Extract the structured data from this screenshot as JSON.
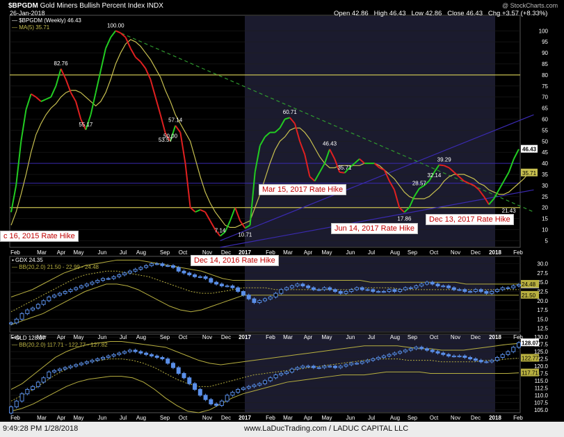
{
  "header": {
    "symbol": "$BPGDM",
    "title": "Gold Miners Bullish Percent Index",
    "exchange": "INDX",
    "date": "26-Jan-2018",
    "watermark": "@ StockCharts.com",
    "open_label": "Open",
    "open": "42.86",
    "high_label": "High",
    "high": "46.43",
    "low_label": "Low",
    "low": "42.86",
    "close_label": "Close",
    "close": "46.43",
    "chg_label": "Chg",
    "chg": "+3.57 (+8.33%)"
  },
  "colors": {
    "up": "#22cc22",
    "down": "#e02020",
    "ma": "#c8c050",
    "trend": "#3a2ab0",
    "dashed": "#2f9a2f",
    "hline": "#c8c050",
    "shade": "#1b1b2e",
    "bar": "#5a8fe8",
    "bb": "#b8b040"
  },
  "footer": {
    "timestamp": "9:49:28 PM 1/28/2018",
    "credit": "www.LaDucTrading.com / LADUC CAPITAL LLC"
  },
  "callouts": [
    "c 16, 2015 Rate Hike",
    "Dec 14, 2016 Rate Hike",
    "Mar 15, 2017 Rate Hike",
    "Jun 14, 2017 Rate Hike",
    "Dec 13, 2017 Rate Hike"
  ],
  "chart_data": [
    {
      "type": "line",
      "legend": [
        "$BPGDM (Weekly) 46.43",
        "MA(5) 35.71"
      ],
      "x_labels": [
        "Feb",
        "Mar",
        "Apr",
        "May",
        "Jun",
        "Jul",
        "Aug",
        "Sep",
        "Oct",
        "Nov",
        "Dec",
        "2017",
        "Feb",
        "Mar",
        "Apr",
        "May",
        "Jun",
        "Jul",
        "Aug",
        "Sep",
        "Oct",
        "Nov",
        "Dec",
        "2018",
        "Feb"
      ],
      "ylim": [
        2,
        107
      ],
      "y_ticks": [
        5,
        10,
        15,
        20,
        25,
        30,
        35,
        40,
        45,
        50,
        55,
        60,
        65,
        70,
        75,
        80,
        85,
        90,
        95,
        100
      ],
      "hlines": [
        80,
        20
      ],
      "hline_blue": [
        31,
        40
      ],
      "last_value_labels": [
        "46.43",
        "35.71"
      ],
      "series": [
        {
          "name": "$BPGDM (Weekly)",
          "values": [
            17.9,
            30,
            50,
            64.3,
            71.4,
            70,
            68,
            69,
            70,
            75,
            82.8,
            78,
            72,
            68,
            60,
            55.2,
            62,
            72,
            82,
            92,
            97,
            100,
            99,
            97,
            92,
            88,
            86,
            83,
            78,
            70,
            62,
            53.6,
            50,
            57.1,
            54,
            40,
            20,
            18,
            19,
            18,
            14,
            10,
            7.1,
            9,
            14,
            20,
            14,
            10.7,
            12,
            36,
            48,
            52,
            54,
            54,
            56,
            60,
            60.7,
            58,
            50,
            44,
            34,
            32,
            36,
            40,
            46.4,
            42,
            36,
            35.7,
            38,
            40,
            42,
            40,
            40,
            40,
            38,
            37,
            32,
            28,
            20,
            17.9,
            20,
            25,
            28.6,
            30,
            32.1,
            36,
            39.3,
            39,
            38,
            36,
            34,
            32,
            31,
            30,
            28,
            25,
            21.4,
            24,
            28,
            32,
            36,
            42,
            46.4
          ]
        },
        {
          "name": "MA(5)",
          "values": [
            12,
            18,
            26,
            35,
            45,
            53,
            58,
            62,
            65,
            67,
            70,
            72,
            73,
            73,
            72,
            70,
            68,
            66,
            68,
            72,
            78,
            85,
            90,
            94,
            96,
            95,
            93,
            90,
            87,
            83,
            79,
            73,
            68,
            62,
            58,
            54,
            50,
            42,
            34,
            27,
            22,
            18,
            15,
            12,
            11,
            11,
            12,
            13,
            14,
            20,
            26,
            33,
            40,
            46,
            50,
            52,
            55,
            56,
            56,
            54,
            51,
            47,
            43,
            40,
            38,
            38,
            39,
            39,
            39,
            39,
            39,
            40,
            40,
            40,
            39,
            37,
            35,
            33,
            30,
            27,
            25,
            24,
            24,
            24,
            25,
            27,
            29,
            32,
            34,
            35,
            35,
            35,
            34,
            33,
            31,
            30,
            28,
            27,
            26,
            26,
            27,
            29,
            31,
            33,
            35.7
          ]
        }
      ],
      "annotations": [
        "100.00",
        "82.76",
        "55.17",
        "53.57",
        "50.00",
        "57.14",
        "7.14",
        "10.71",
        "60.71",
        "46.43",
        "35.71",
        "17.86",
        "28.57",
        "32.14",
        "39.29",
        "21.43"
      ]
    },
    {
      "type": "candlestick",
      "legend": [
        "GDX 24.35",
        "BB(20,2.0) 21.50 - 22.99 - 24.48"
      ],
      "ylim": [
        11.5,
        32
      ],
      "y_ticks": [
        12.5,
        15.0,
        17.5,
        20.0,
        22.5,
        25.0,
        27.5,
        30.0
      ],
      "last_value_labels": [
        "24.35",
        "24.48",
        "21.50"
      ],
      "close_series": [
        14.0,
        15.0,
        16.5,
        17.5,
        18.0,
        19.0,
        20.0,
        21.0,
        21.5,
        22.0,
        22.5,
        23.0,
        23.5,
        24.0,
        24.5,
        25.0,
        25.5,
        26.0,
        26.0,
        26.5,
        27.0,
        27.5,
        28.0,
        28.5,
        29.0,
        29.5,
        30.0,
        30.0,
        29.5,
        29.5,
        29.0,
        28.0,
        27.5,
        27.0,
        26.5,
        26.5,
        26.0,
        25.0,
        24.5,
        24.0,
        24.0,
        23.5,
        22.5,
        21.5,
        20.5,
        19.5,
        20.0,
        20.5,
        21.0,
        22.0,
        23.0,
        23.5,
        24.0,
        24.5,
        24.0,
        23.5,
        23.0,
        23.0,
        23.5,
        23.0,
        22.5,
        22.0,
        22.5,
        23.0,
        23.5,
        23.0,
        23.0,
        22.5,
        22.5,
        22.5,
        23.0,
        22.5,
        23.0,
        23.5,
        23.5,
        24.0,
        24.5,
        25.0,
        24.5,
        24.0,
        24.0,
        23.5,
        23.0,
        23.0,
        22.5,
        22.5,
        23.0,
        22.5,
        22.0,
        22.5,
        23.0,
        23.5,
        23.5,
        24.0,
        24.35
      ],
      "series": [
        {
          "name": "BB upper",
          "values": [
            21.0,
            22.0,
            23.0,
            24.5,
            26.0,
            27.5,
            28.5,
            29.5,
            30.0,
            30.5,
            31.0,
            31.0,
            31.0,
            30.5,
            30.0,
            29.5,
            29.0,
            28.5,
            28.0,
            27.0,
            26.0,
            25.5,
            25.5,
            25.5,
            25.5,
            25.5,
            25.5,
            25.5,
            25.5,
            25.5,
            25.5,
            25.5,
            25.5,
            25.5,
            25.0,
            25.0,
            25.0,
            25.0,
            25.0,
            25.0,
            25.0,
            25.0,
            25.0,
            24.5,
            24.5,
            24.5,
            24.5,
            24.5,
            24.5
          ]
        },
        {
          "name": "BB mid",
          "values": [
            17.0,
            18.5,
            20.0,
            21.5,
            23.0,
            24.5,
            26.0,
            27.0,
            27.5,
            28.0,
            28.0,
            27.5,
            27.0,
            26.5,
            25.5,
            24.5,
            23.5,
            22.5,
            22.0,
            22.0,
            22.5,
            23.0,
            23.5,
            23.5,
            23.5,
            23.0,
            23.0,
            23.0,
            23.0,
            23.0,
            23.0,
            23.0,
            23.0,
            23.5,
            23.5,
            23.5,
            23.5,
            23.0,
            23.0,
            23.0,
            23.0,
            23.0,
            23.0,
            23.0,
            23.0,
            23.0,
            23.0,
            23.0,
            22.99
          ]
        },
        {
          "name": "BB lower",
          "values": [
            13.5,
            14.5,
            15.5,
            16.5,
            18.0,
            19.5,
            21.0,
            22.5,
            23.5,
            24.5,
            24.5,
            24.0,
            23.0,
            21.5,
            20.0,
            18.5,
            17.5,
            17.0,
            17.5,
            18.5,
            19.5,
            20.5,
            21.5,
            21.5,
            21.5,
            21.5,
            21.5,
            21.5,
            21.5,
            21.5,
            21.5,
            21.5,
            21.5,
            21.5,
            21.5,
            21.5,
            21.5,
            21.5,
            21.5,
            21.5,
            21.5,
            21.5,
            21.5,
            21.5,
            21.5,
            21.5,
            21.5,
            21.5,
            21.5
          ]
        }
      ]
    },
    {
      "type": "candlestick",
      "legend": [
        "GLD 128.07",
        "BB(20,2.0) 117.71 - 122.77 - 127.82"
      ],
      "ylim": [
        104,
        131
      ],
      "y_ticks": [
        105.0,
        107.5,
        110.0,
        112.5,
        115.0,
        117.5,
        120.0,
        122.5,
        125.0,
        127.5,
        130.0
      ],
      "last_value_labels": [
        "128.07",
        "122.77",
        "117.71"
      ],
      "close_series": [
        106.0,
        108.0,
        110.5,
        112.0,
        113.0,
        114.5,
        116.0,
        118.0,
        118.5,
        119.0,
        119.5,
        120.0,
        120.5,
        121.0,
        121.5,
        122.0,
        122.5,
        123.0,
        123.5,
        124.0,
        124.5,
        125.0,
        125.5,
        125.0,
        124.5,
        124.0,
        123.5,
        123.0,
        122.5,
        121.0,
        119.5,
        117.5,
        116.0,
        114.0,
        112.0,
        110.0,
        108.5,
        107.0,
        106.5,
        108.0,
        110.0,
        111.0,
        112.0,
        112.5,
        113.0,
        113.5,
        114.0,
        115.0,
        116.0,
        117.0,
        117.5,
        118.0,
        119.0,
        119.5,
        120.0,
        120.0,
        119.5,
        119.5,
        120.0,
        120.0,
        119.5,
        120.0,
        120.5,
        121.0,
        121.0,
        121.5,
        122.0,
        122.5,
        123.0,
        123.5,
        124.0,
        124.5,
        125.0,
        125.5,
        126.0,
        126.5,
        126.0,
        125.5,
        125.0,
        124.5,
        124.0,
        123.5,
        123.5,
        123.5,
        123.0,
        122.5,
        122.0,
        121.5,
        121.5,
        122.0,
        123.0,
        124.0,
        125.0,
        126.5,
        128.07
      ],
      "series": [
        {
          "name": "BB upper",
          "values": [
            112.0,
            114.0,
            117.0,
            120.0,
            123.0,
            125.0,
            126.5,
            127.5,
            128.0,
            128.5,
            128.5,
            128.0,
            127.5,
            127.0,
            126.5,
            125.0,
            123.5,
            122.0,
            121.0,
            120.5,
            121.0,
            121.5,
            122.0,
            122.5,
            123.0,
            123.5,
            124.0,
            124.5,
            125.0,
            125.5,
            126.0,
            126.5,
            127.0,
            127.0,
            127.0,
            127.0,
            126.5,
            126.0,
            126.0,
            125.5,
            125.5,
            125.5,
            126.0,
            126.5,
            127.0,
            127.5,
            127.82
          ]
        },
        {
          "name": "BB mid",
          "values": [
            108.0,
            110.0,
            112.0,
            114.5,
            117.0,
            119.0,
            120.5,
            121.5,
            122.0,
            122.5,
            122.5,
            122.0,
            121.0,
            119.5,
            117.5,
            115.5,
            114.0,
            113.0,
            113.0,
            114.0,
            115.0,
            116.0,
            117.0,
            117.5,
            118.0,
            118.5,
            119.0,
            119.5,
            120.0,
            120.5,
            121.0,
            121.5,
            122.0,
            122.5,
            122.5,
            122.5,
            122.0,
            122.0,
            122.0,
            121.5,
            121.5,
            121.5,
            121.5,
            122.0,
            122.0,
            122.5,
            122.77
          ]
        },
        {
          "name": "BB lower",
          "values": [
            104.5,
            105.5,
            107.0,
            109.0,
            111.0,
            113.0,
            114.5,
            115.5,
            116.0,
            116.5,
            116.5,
            116.0,
            114.5,
            112.0,
            109.0,
            106.5,
            104.5,
            104.0,
            105.0,
            107.0,
            109.0,
            110.5,
            111.5,
            112.5,
            113.5,
            114.5,
            115.0,
            115.5,
            116.0,
            116.5,
            117.0,
            117.0,
            117.0,
            117.5,
            118.0,
            118.0,
            118.0,
            118.0,
            117.5,
            117.5,
            117.5,
            117.5,
            117.5,
            117.5,
            117.5,
            117.5,
            117.71
          ]
        }
      ]
    }
  ]
}
